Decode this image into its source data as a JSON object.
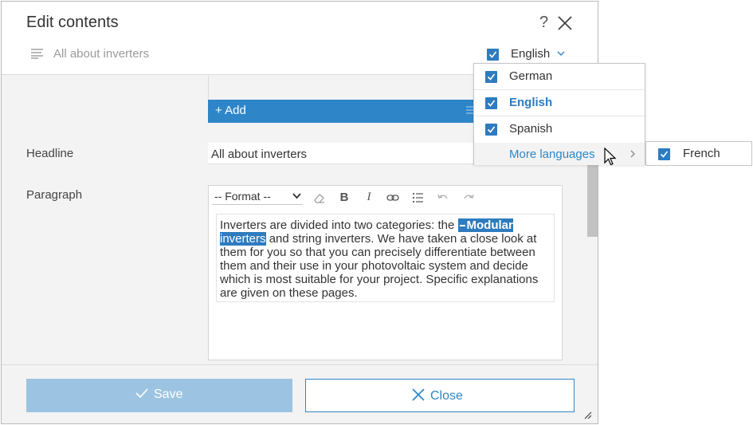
{
  "dialog": {
    "title": "Edit contents",
    "help_label": "?",
    "subtitle": "All about inverters"
  },
  "language": {
    "current": "English",
    "options": [
      {
        "label": "German",
        "checked": true,
        "active": false
      },
      {
        "label": "English",
        "checked": true,
        "active": true
      },
      {
        "label": "Spanish",
        "checked": true,
        "active": false
      }
    ],
    "more_label": "More languages",
    "more_options": [
      {
        "label": "French",
        "checked": true
      }
    ]
  },
  "content": {
    "add_label": "+ Add",
    "headline_label": "Headline",
    "headline_value": "All about inverters",
    "paragraph_label": "Paragraph",
    "format_label": "-- Format --",
    "paragraph_text": {
      "before": "Inverters are divided into two categories: the ",
      "link_word1": "Modular",
      "link_word2": "inverters",
      "after": " and string inverters. We have taken a close look at them for you so that you can precisely differentiate between them and their use in your photovoltaic system and decide which is most suitable for your project. Specific explanations are given on these pages."
    }
  },
  "footer": {
    "save_label": "Save",
    "close_label": "Close"
  },
  "colors": {
    "accent": "#2e86c8",
    "checkbox": "#2e7bbf",
    "save_disabled": "#9cc4e2"
  },
  "icons": [
    "help-icon",
    "close-icon",
    "lines-icon",
    "chevron-down-icon",
    "drag-handle-icon",
    "eraser-icon",
    "bold-icon",
    "italic-icon",
    "link-icon",
    "list-icon",
    "undo-icon",
    "redo-icon",
    "check-icon",
    "chevron-right-icon",
    "resize-icon",
    "mouse-pointer-icon"
  ]
}
